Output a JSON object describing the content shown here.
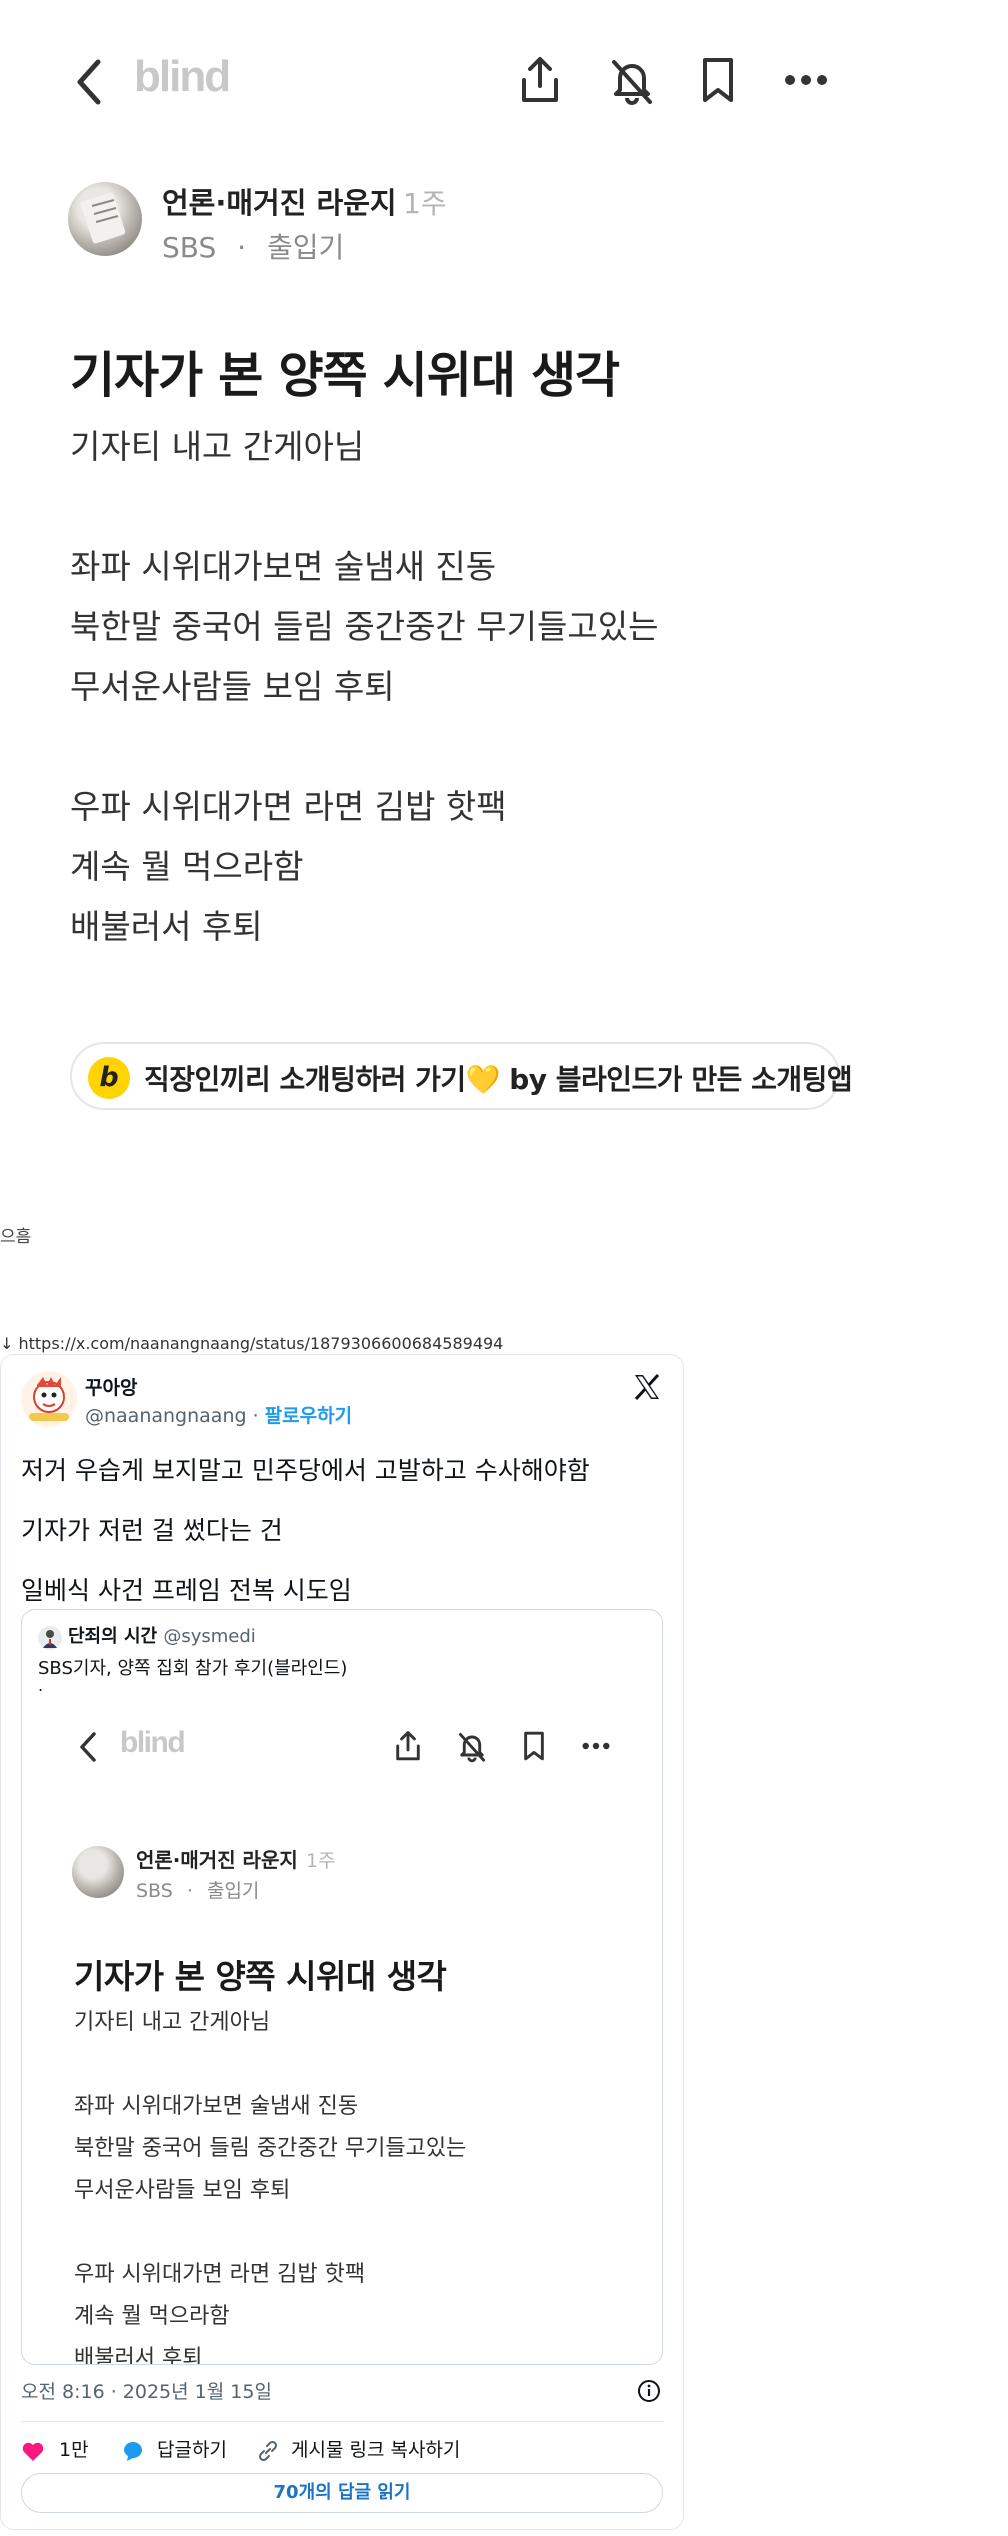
{
  "blind_post": {
    "logo": "blind",
    "author": "언론·매거진 라운지",
    "time": "1주",
    "company": "SBS",
    "separator": "·",
    "status": "출입기",
    "title": "기자가 본 양쪽 시위대 생각",
    "lines": [
      "기자티 내고 간게아님",
      "좌파 시위대가보면 술냄새 진동",
      "북한말 중국어 들림 중간중간 무기들고있는",
      "무서운사람들 보임 후퇴",
      "우파 시위대가면 라면 김밥 핫팩",
      "계속 뭘 먹으라함",
      "배불러서 후퇴"
    ],
    "ad": {
      "badge": "b",
      "text": "직장인끼리 소개팅하러 가기💛 by 블라인드가 만든 소개팅앱"
    },
    "icons": [
      "back-icon",
      "share-icon",
      "bell-off-icon",
      "bookmark-icon",
      "more-icon"
    ]
  },
  "stray_text": "으흠",
  "source_url": "↓ https://x.com/naanangnaang/status/1879306600684589494",
  "tweet": {
    "name": "꾸아앙",
    "handle": "@naanangnaang",
    "dot": "·",
    "follow_label": "팔로우하기",
    "body_lines": [
      "저거 우습게 보지말고 민주당에서 고발하고 수사해야함",
      "기자가 저런 걸 썼다는 건",
      "일베식 사건 프레임 전복 시도임"
    ],
    "quote": {
      "name": "단죄의 시간",
      "handle": "@sysmedi",
      "text": "SBS기자, 양쪽 집회 참가 후기(블라인드)",
      "dot": "."
    },
    "timestamp": "오전 8:16 · 2025년 1월 15일",
    "likes": "1만",
    "reply_label": "답글하기",
    "copy_link_label": "게시물 링크 복사하기",
    "read_replies_label": "70개의 답글 읽기",
    "colors": {
      "like": "#f91880",
      "reply": "#1d9bf0",
      "follow": "#1d9bf0"
    }
  }
}
